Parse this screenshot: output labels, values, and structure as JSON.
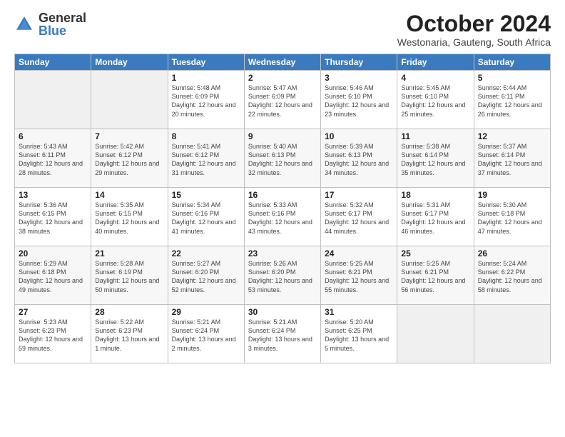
{
  "logo": {
    "general": "General",
    "blue": "Blue"
  },
  "title": {
    "month_year": "October 2024",
    "location": "Westonaria, Gauteng, South Africa"
  },
  "weekdays": [
    "Sunday",
    "Monday",
    "Tuesday",
    "Wednesday",
    "Thursday",
    "Friday",
    "Saturday"
  ],
  "weeks": [
    [
      {
        "day": "",
        "info": ""
      },
      {
        "day": "",
        "info": ""
      },
      {
        "day": "1",
        "info": "Sunrise: 5:48 AM\nSunset: 6:09 PM\nDaylight: 12 hours and 20 minutes."
      },
      {
        "day": "2",
        "info": "Sunrise: 5:47 AM\nSunset: 6:09 PM\nDaylight: 12 hours and 22 minutes."
      },
      {
        "day": "3",
        "info": "Sunrise: 5:46 AM\nSunset: 6:10 PM\nDaylight: 12 hours and 23 minutes."
      },
      {
        "day": "4",
        "info": "Sunrise: 5:45 AM\nSunset: 6:10 PM\nDaylight: 12 hours and 25 minutes."
      },
      {
        "day": "5",
        "info": "Sunrise: 5:44 AM\nSunset: 6:11 PM\nDaylight: 12 hours and 26 minutes."
      }
    ],
    [
      {
        "day": "6",
        "info": "Sunrise: 5:43 AM\nSunset: 6:11 PM\nDaylight: 12 hours and 28 minutes."
      },
      {
        "day": "7",
        "info": "Sunrise: 5:42 AM\nSunset: 6:12 PM\nDaylight: 12 hours and 29 minutes."
      },
      {
        "day": "8",
        "info": "Sunrise: 5:41 AM\nSunset: 6:12 PM\nDaylight: 12 hours and 31 minutes."
      },
      {
        "day": "9",
        "info": "Sunrise: 5:40 AM\nSunset: 6:13 PM\nDaylight: 12 hours and 32 minutes."
      },
      {
        "day": "10",
        "info": "Sunrise: 5:39 AM\nSunset: 6:13 PM\nDaylight: 12 hours and 34 minutes."
      },
      {
        "day": "11",
        "info": "Sunrise: 5:38 AM\nSunset: 6:14 PM\nDaylight: 12 hours and 35 minutes."
      },
      {
        "day": "12",
        "info": "Sunrise: 5:37 AM\nSunset: 6:14 PM\nDaylight: 12 hours and 37 minutes."
      }
    ],
    [
      {
        "day": "13",
        "info": "Sunrise: 5:36 AM\nSunset: 6:15 PM\nDaylight: 12 hours and 38 minutes."
      },
      {
        "day": "14",
        "info": "Sunrise: 5:35 AM\nSunset: 6:15 PM\nDaylight: 12 hours and 40 minutes."
      },
      {
        "day": "15",
        "info": "Sunrise: 5:34 AM\nSunset: 6:16 PM\nDaylight: 12 hours and 41 minutes."
      },
      {
        "day": "16",
        "info": "Sunrise: 5:33 AM\nSunset: 6:16 PM\nDaylight: 12 hours and 43 minutes."
      },
      {
        "day": "17",
        "info": "Sunrise: 5:32 AM\nSunset: 6:17 PM\nDaylight: 12 hours and 44 minutes."
      },
      {
        "day": "18",
        "info": "Sunrise: 5:31 AM\nSunset: 6:17 PM\nDaylight: 12 hours and 46 minutes."
      },
      {
        "day": "19",
        "info": "Sunrise: 5:30 AM\nSunset: 6:18 PM\nDaylight: 12 hours and 47 minutes."
      }
    ],
    [
      {
        "day": "20",
        "info": "Sunrise: 5:29 AM\nSunset: 6:18 PM\nDaylight: 12 hours and 49 minutes."
      },
      {
        "day": "21",
        "info": "Sunrise: 5:28 AM\nSunset: 6:19 PM\nDaylight: 12 hours and 50 minutes."
      },
      {
        "day": "22",
        "info": "Sunrise: 5:27 AM\nSunset: 6:20 PM\nDaylight: 12 hours and 52 minutes."
      },
      {
        "day": "23",
        "info": "Sunrise: 5:26 AM\nSunset: 6:20 PM\nDaylight: 12 hours and 53 minutes."
      },
      {
        "day": "24",
        "info": "Sunrise: 5:25 AM\nSunset: 6:21 PM\nDaylight: 12 hours and 55 minutes."
      },
      {
        "day": "25",
        "info": "Sunrise: 5:25 AM\nSunset: 6:21 PM\nDaylight: 12 hours and 56 minutes."
      },
      {
        "day": "26",
        "info": "Sunrise: 5:24 AM\nSunset: 6:22 PM\nDaylight: 12 hours and 58 minutes."
      }
    ],
    [
      {
        "day": "27",
        "info": "Sunrise: 5:23 AM\nSunset: 6:23 PM\nDaylight: 12 hours and 59 minutes."
      },
      {
        "day": "28",
        "info": "Sunrise: 5:22 AM\nSunset: 6:23 PM\nDaylight: 13 hours and 1 minute."
      },
      {
        "day": "29",
        "info": "Sunrise: 5:21 AM\nSunset: 6:24 PM\nDaylight: 13 hours and 2 minutes."
      },
      {
        "day": "30",
        "info": "Sunrise: 5:21 AM\nSunset: 6:24 PM\nDaylight: 13 hours and 3 minutes."
      },
      {
        "day": "31",
        "info": "Sunrise: 5:20 AM\nSunset: 6:25 PM\nDaylight: 13 hours and 5 minutes."
      },
      {
        "day": "",
        "info": ""
      },
      {
        "day": "",
        "info": ""
      }
    ]
  ]
}
